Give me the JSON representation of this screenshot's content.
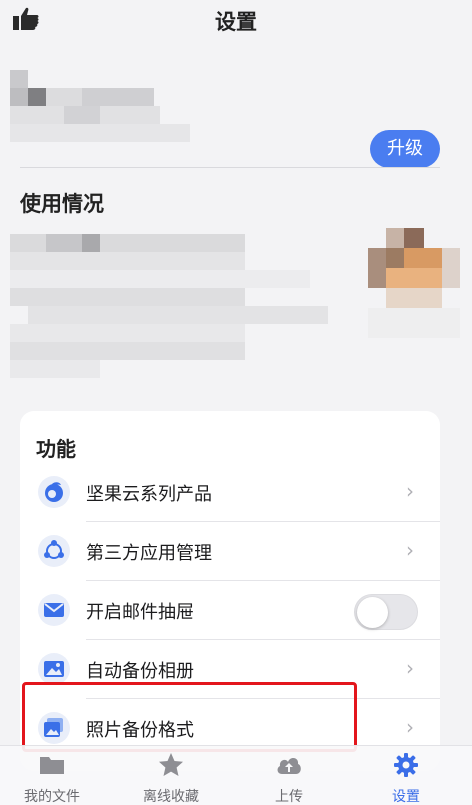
{
  "header": {
    "title": "设置",
    "thumb_icon": "thumbs-up-icon"
  },
  "account": {
    "upgrade_label": "升级",
    "accent": "#4a7df0"
  },
  "usage": {
    "title": "使用情况"
  },
  "features": {
    "title": "功能",
    "items": [
      {
        "label": "坚果云系列产品",
        "icon": "nut-icon",
        "control": "chevron"
      },
      {
        "label": "第三方应用管理",
        "icon": "apps-network-icon",
        "control": "chevron"
      },
      {
        "label": "开启邮件抽屉",
        "icon": "mail-icon",
        "control": "toggle",
        "enabled": false
      },
      {
        "label": "自动备份相册",
        "icon": "photo-icon",
        "control": "chevron"
      },
      {
        "label": "照片备份格式",
        "icon": "photo-format-icon",
        "control": "chevron"
      }
    ],
    "chevron_glyph": "›"
  },
  "tabbar": {
    "tabs": [
      {
        "label": "我的文件",
        "icon": "folder-icon",
        "active": false
      },
      {
        "label": "离线收藏",
        "icon": "star-icon",
        "active": false
      },
      {
        "label": "上传",
        "icon": "upload-cloud-icon",
        "active": false
      },
      {
        "label": "设置",
        "icon": "gear-icon",
        "active": true
      }
    ],
    "active_color": "#3b6ee8"
  },
  "highlight_color": "#e3161c"
}
